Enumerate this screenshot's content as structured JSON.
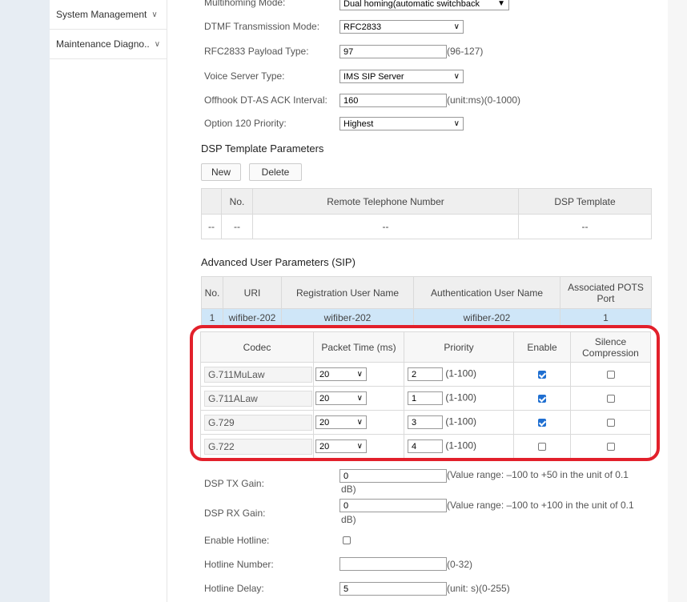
{
  "sidebar": {
    "items": [
      {
        "label": "System Management"
      },
      {
        "label": "Maintenance Diagno.."
      }
    ]
  },
  "form": {
    "multihoming_label": "Multihoming Mode:",
    "multihoming_value": "Dual homing(automatic switchback",
    "dtmf_label": "DTMF Transmission Mode:",
    "dtmf_value": "RFC2833",
    "rfc_label": "RFC2833 Payload Type:",
    "rfc_value": "97",
    "rfc_hint": "(96-127)",
    "voice_label": "Voice Server Type:",
    "voice_value": "IMS SIP Server",
    "offhook_label": "Offhook DT-AS ACK Interval:",
    "offhook_value": "160",
    "offhook_hint": "(unit:ms)(0-1000)",
    "option_label": "Option 120 Priority:",
    "option_value": "Highest"
  },
  "dsp_template": {
    "title": "DSP Template Parameters",
    "new_label": "New",
    "delete_label": "Delete",
    "headers": [
      "",
      "No.",
      "Remote Telephone Number",
      "DSP Template"
    ],
    "row": [
      "--",
      "--",
      "--",
      "--"
    ]
  },
  "advanced": {
    "title": "Advanced User Parameters (SIP)",
    "headers": [
      "No.",
      "URI",
      "Registration User Name",
      "Authentication User Name",
      "Associated POTS Port"
    ],
    "row": [
      "1",
      "wifiber-202",
      "wifiber-202",
      "wifiber-202",
      "1"
    ]
  },
  "codec_table": {
    "headers": [
      "Codec",
      "Packet Time (ms)",
      "Priority",
      "Enable",
      "Silence Compression"
    ],
    "rows": [
      {
        "codec": "G.711MuLaw",
        "packet": "20",
        "priority": "2",
        "range": "(1-100)",
        "enable": true,
        "silence": false
      },
      {
        "codec": "G.711ALaw",
        "packet": "20",
        "priority": "1",
        "range": "(1-100)",
        "enable": true,
        "silence": false
      },
      {
        "codec": "G.729",
        "packet": "20",
        "priority": "3",
        "range": "(1-100)",
        "enable": true,
        "silence": false
      },
      {
        "codec": "G.722",
        "packet": "20",
        "priority": "4",
        "range": "(1-100)",
        "enable": false,
        "silence": false
      }
    ]
  },
  "lower": {
    "tx_label": "DSP TX Gain:",
    "tx_value": "0",
    "tx_hint1": "(Value range: –100 to +50 in the unit of 0.1",
    "tx_hint2": "dB)",
    "rx_label": "DSP RX Gain:",
    "rx_value": "0",
    "rx_hint1": "(Value range: –100 to +100 in the unit of 0.1",
    "rx_hint2": "dB)",
    "hotline_enable_label": "Enable Hotline:",
    "hotline_number_label": "Hotline Number:",
    "hotline_number_value": "",
    "hotline_number_hint": "(0-32)",
    "hotline_delay_label": "Hotline Delay:",
    "hotline_delay_value": "5",
    "hotline_delay_hint": "(unit: s)(0-255)"
  },
  "colors": {
    "highlight": "#e2202b",
    "selected_row": "#cfe6f8",
    "checkbox": "#1f6fd1"
  }
}
